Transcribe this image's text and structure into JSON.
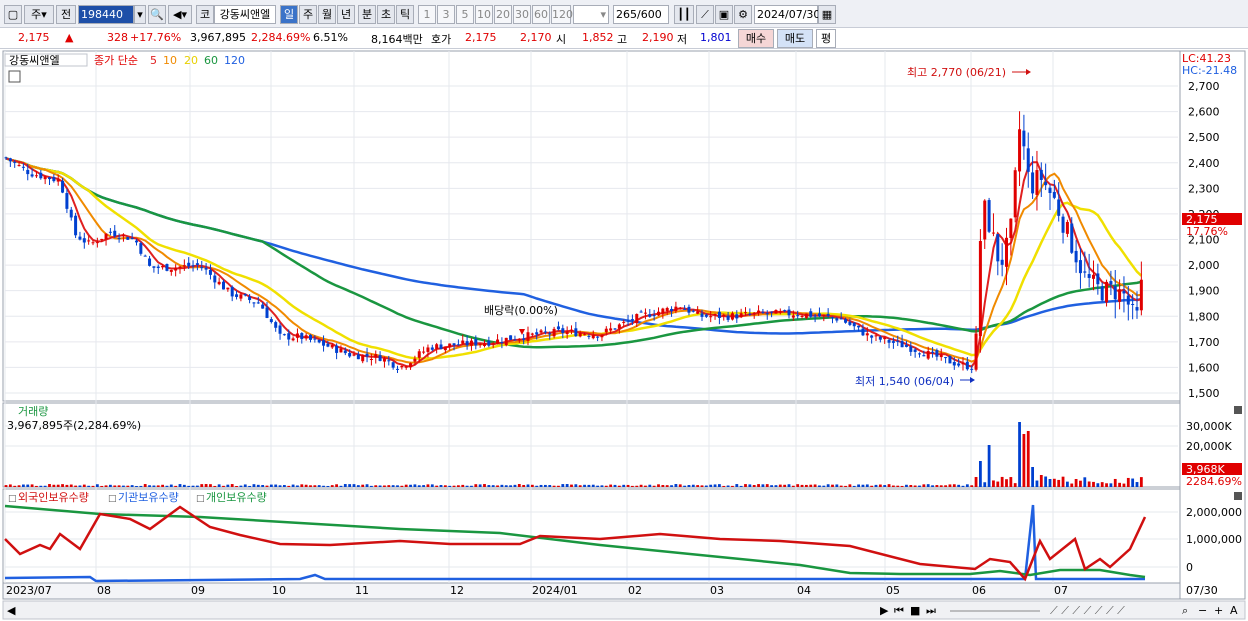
{
  "toolbar": {
    "market": "주",
    "type": "전",
    "code": "198440",
    "code_prefix": "코",
    "stock_name": "강동씨앤엘",
    "periods": [
      "일",
      "주",
      "월",
      "년",
      "분",
      "초",
      "틱"
    ],
    "active_period": "일",
    "intervals": [
      "1",
      "3",
      "5",
      "10",
      "20",
      "30",
      "60",
      "120"
    ],
    "count": "265",
    "count_max": "/600",
    "date": "2024/07/30"
  },
  "quote": {
    "price": "2,175",
    "arrow": "▲",
    "change": "328",
    "change_pct": "+17.76%",
    "volume": "3,967,895",
    "volume_pct": "2,284.69%",
    "turnover": "6.51%",
    "amount": "8,164백만",
    "bid_label": "호가",
    "bid_ask": "2,175",
    "bid": "2,170",
    "open_label": "시",
    "open": "1,852",
    "high_label": "고",
    "high": "2,190",
    "low_label": "저",
    "low": "1,801",
    "buy_label": "매수",
    "sell_label": "매도",
    "avg_label": "평"
  },
  "price_panel": {
    "title": "강동씨앤엘",
    "ma_label": "종가 단순",
    "ma_periods": [
      {
        "n": "5",
        "color": "#e02020"
      },
      {
        "n": "10",
        "color": "#f08a00"
      },
      {
        "n": "20",
        "color": "#f0e000"
      },
      {
        "n": "60",
        "color": "#1a9640"
      },
      {
        "n": "120",
        "color": "#2060e0"
      }
    ],
    "lc": "LC:41.23",
    "hc": "HC:-21.48",
    "y_ticks": [
      "2,700",
      "2,600",
      "2,500",
      "2,400",
      "2,300",
      "2,200",
      "2,100",
      "2,000",
      "1,900",
      "1,800",
      "1,700",
      "1,600",
      "1,500"
    ],
    "max_label": "최고 2,770 (06/21)",
    "min_label": "최저 1,540 (06/04)",
    "dividend_label": "배당락(0.00%)",
    "current_price": "2,175",
    "current_pct": "17.76%"
  },
  "volume_panel": {
    "title": "거래량",
    "value": "3,967,895주(2,284.69%)",
    "y_ticks": [
      "30,000K",
      "20,000K"
    ],
    "current": "3,968K",
    "current_pct": "2284.69%"
  },
  "investor_panel": {
    "legends": [
      {
        "label": "외국인보유수량",
        "color": "#d01010"
      },
      {
        "label": "기관보유수량",
        "color": "#2060e0"
      },
      {
        "label": "개인보유수량",
        "color": "#1a9640"
      }
    ],
    "y_ticks": [
      "2,000,000",
      "1,000,000",
      "0"
    ]
  },
  "x_axis": {
    "labels": [
      "2023/07",
      "08",
      "09",
      "10",
      "11",
      "12",
      "2024/01",
      "02",
      "03",
      "04",
      "05",
      "06",
      "07"
    ],
    "end_label": "07/30"
  },
  "colors": {
    "up": "#e00000",
    "down": "#0040d0",
    "ma5": "#e02020",
    "ma10": "#f08a00",
    "ma20": "#f0e000",
    "ma60": "#1a9640",
    "ma120": "#2060e0"
  }
}
